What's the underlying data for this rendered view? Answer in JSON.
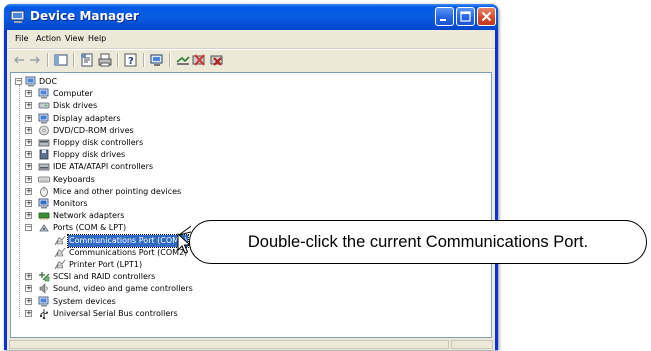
{
  "window": {
    "title": "Device Manager"
  },
  "menu": {
    "file": "File",
    "action": "Action",
    "view": "View",
    "help": "Help"
  },
  "tree": {
    "root": "DOC",
    "items": [
      {
        "label": "Computer",
        "icon": "computer-icon"
      },
      {
        "label": "Disk drives",
        "icon": "disk-drive-icon"
      },
      {
        "label": "Display adapters",
        "icon": "display-adapter-icon"
      },
      {
        "label": "DVD/CD-ROM drives",
        "icon": "dvd-drive-icon"
      },
      {
        "label": "Floppy disk controllers",
        "icon": "floppy-controller-icon"
      },
      {
        "label": "Floppy disk drives",
        "icon": "floppy-drive-icon"
      },
      {
        "label": "IDE ATA/ATAPI controllers",
        "icon": "ide-controller-icon"
      },
      {
        "label": "Keyboards",
        "icon": "keyboard-icon"
      },
      {
        "label": "Mice and other pointing devices",
        "icon": "mouse-icon"
      },
      {
        "label": "Monitors",
        "icon": "monitor-icon"
      },
      {
        "label": "Network adapters",
        "icon": "network-adapter-icon"
      },
      {
        "label": "Ports (COM & LPT)",
        "icon": "port-icon",
        "expanded": true,
        "children": [
          {
            "label": "Communications Port (COM1)",
            "selected": true
          },
          {
            "label": "Communications Port (COM2)"
          },
          {
            "label": "Printer Port (LPT1)"
          }
        ]
      },
      {
        "label": "SCSI and RAID controllers",
        "icon": "scsi-icon"
      },
      {
        "label": "Sound, video and game controllers",
        "icon": "sound-icon"
      },
      {
        "label": "System devices",
        "icon": "system-devices-icon"
      },
      {
        "label": "Universal Serial Bus controllers",
        "icon": "usb-icon"
      }
    ]
  },
  "callout": {
    "text": "Double-click the current Communications Port."
  },
  "colors": {
    "titlebar": "#0a5ee5",
    "selection": "#316ac5",
    "frame": "#ece9d8"
  }
}
